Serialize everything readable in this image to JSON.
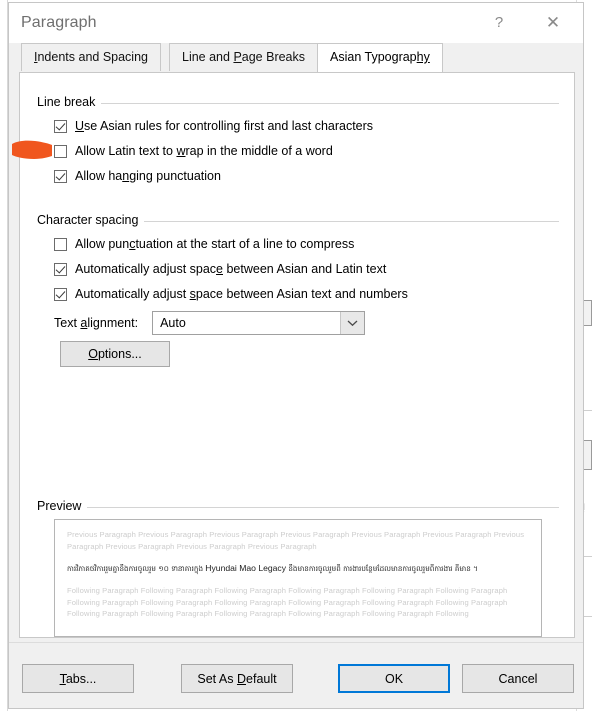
{
  "window": {
    "title": "Paragraph",
    "help_icon": "question-mark-icon",
    "help_label": "?",
    "close_icon": "close-icon",
    "close_label": "✕"
  },
  "tabs": [
    {
      "label_pre": "",
      "label_underlined": "I",
      "label_post": "ndents and Spacing",
      "active": false
    },
    {
      "label_pre": "Line and ",
      "label_underlined": "P",
      "label_post": "age Breaks",
      "active": false
    },
    {
      "label_pre": "Asian Typograp",
      "label_underlined": "hy",
      "label_post": "",
      "active": true
    }
  ],
  "line_break": {
    "group_title": "Line break",
    "options": [
      {
        "checked": true,
        "pre": "",
        "underlined": "U",
        "post": "se Asian rules for controlling first and last characters"
      },
      {
        "checked": false,
        "pre": "Allow Latin text to ",
        "underlined": "w",
        "post": "rap in the middle of a word"
      },
      {
        "checked": true,
        "pre": "Allow ha",
        "underlined": "n",
        "post": "ging punctuation"
      }
    ]
  },
  "character_spacing": {
    "group_title": "Character spacing",
    "options": [
      {
        "checked": false,
        "pre": "Allow pun",
        "underlined": "c",
        "post": "tuation at the start of a line to compress"
      },
      {
        "checked": true,
        "pre": "Automatically adjust spac",
        "underlined": "e",
        "post": " between Asian and Latin text"
      },
      {
        "checked": true,
        "pre": "Automatically adjust ",
        "underlined": "s",
        "post": "pace between Asian text and numbers"
      }
    ],
    "alignment": {
      "label_pre": "Text ",
      "label_underlined": "a",
      "label_post": "lignment:",
      "value": "Auto",
      "arrow_icon": "chevron-down-icon"
    },
    "options_button": {
      "pre": "",
      "underlined": "O",
      "post": "ptions..."
    }
  },
  "preview": {
    "group_title": "Preview",
    "previous_paragraph": "Previous Paragraph Previous Paragraph Previous Paragraph Previous Paragraph Previous Paragraph Previous Paragraph Previous Paragraph Previous Paragraph Previous Paragraph Previous Paragraph",
    "current_paragraph_before": "ការវិភាគថវិការរួមគ្នានឹងការចូលរួម ១០ ទានាគារក្នុង ",
    "current_paragraph_latin": "Hyundai Mao Legacy",
    "current_paragraph_after": " នឹងមានការចូលរួមពី ការងារបន្ថែមដែលមានការចូលរួមពីការងារ គី",
    "current_paragraph_tail": "មាន ។",
    "following_paragraph": "Following Paragraph Following Paragraph Following Paragraph Following Paragraph Following Paragraph Following Paragraph Following Paragraph Following Paragraph Following Paragraph Following Paragraph Following Paragraph Following Paragraph Following Paragraph Following Paragraph Following Paragraph Following Paragraph Following Paragraph Following"
  },
  "buttons": {
    "tabs": {
      "pre": "",
      "underlined": "T",
      "post": "abs..."
    },
    "set_default": {
      "pre": "Set As ",
      "underlined": "D",
      "post": "efault"
    },
    "ok": {
      "pre": "OK",
      "underlined": "",
      "post": ""
    },
    "cancel": {
      "pre": "Cancel",
      "underlined": "",
      "post": ""
    }
  },
  "annotation": {
    "type": "brush-stroke-highlight",
    "color": "#F0561E",
    "points_at": "Allow Latin text to wrap in the middle of a word"
  },
  "colors": {
    "accent_focus": "#0078D7",
    "dialog_bg": "#F0F0F0",
    "panel_bg": "#FFFFFF",
    "annotation_orange": "#F0561E",
    "title_text": "#6F6F6F",
    "preview_dim_text": "#CDCDCD"
  }
}
